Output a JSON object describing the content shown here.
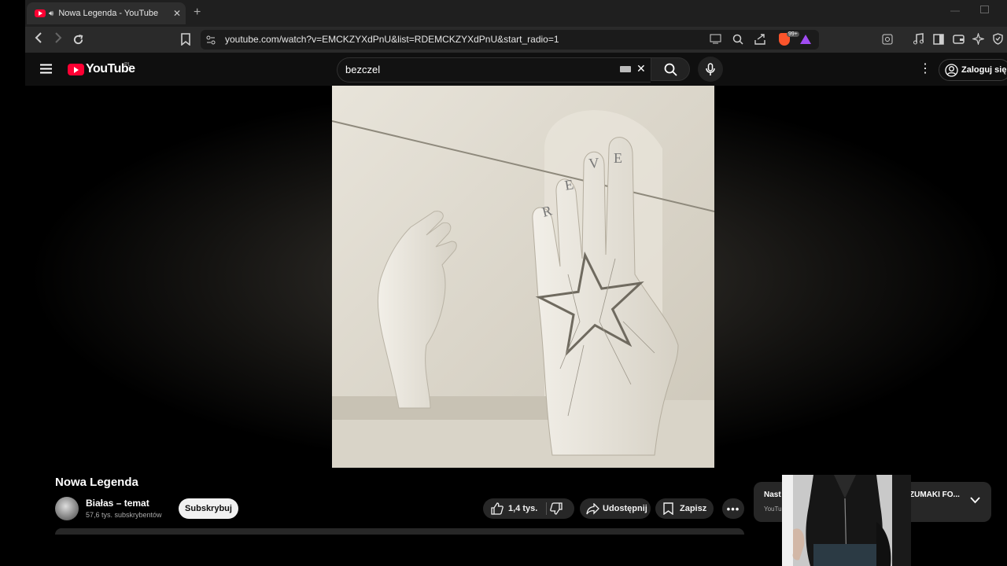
{
  "browser": {
    "tab_title": "Nowa Legenda - YouTube",
    "new_tab": "+",
    "url": "youtube.com/watch?v=EMCKZYXdPnU&list=RDEMCKZYXdPnU&start_radio=1",
    "brave_badge": "99+"
  },
  "header": {
    "logo_text": "YouTube",
    "country": "PL",
    "search_value": "bezczel",
    "sign_in": "Zaloguj się"
  },
  "video": {
    "title": "Nowa Legenda",
    "letters": [
      "R",
      "E",
      "V",
      "E"
    ]
  },
  "channel": {
    "name": "Białas – temat",
    "subscribers": "57,6 tys. subskrybentów",
    "subscribe": "Subskrybuj"
  },
  "actions": {
    "likes": "1,4 tys.",
    "share": "Udostępnij",
    "save": "Zapisz"
  },
  "next_up": {
    "label": "Nast",
    "sub": "YouTu",
    "title": "ZUMAKI FO..."
  },
  "colors": {
    "youtube_red": "#ff0033",
    "page_bg": "#0f0f0f",
    "pill_bg": "#272727"
  }
}
